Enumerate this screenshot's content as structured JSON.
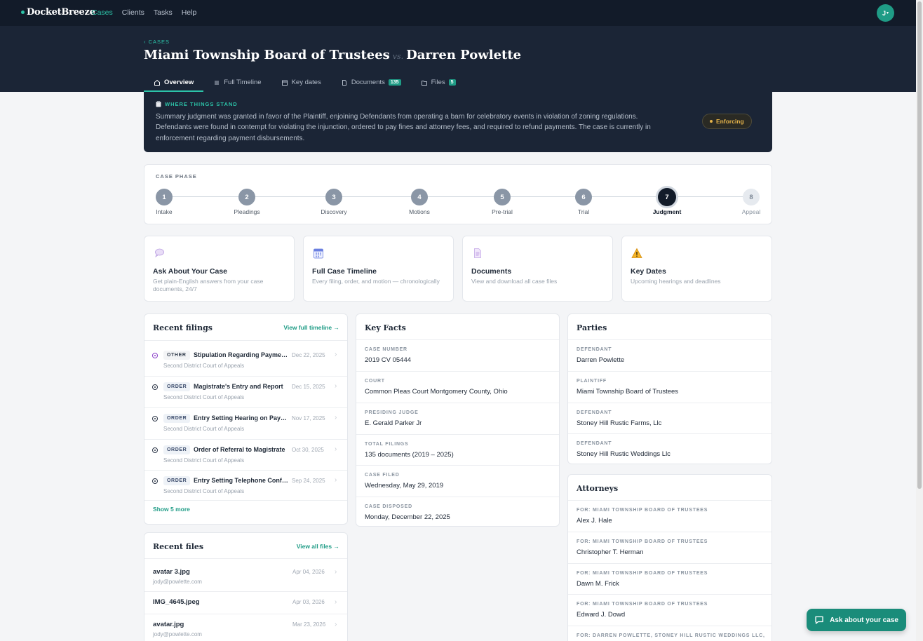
{
  "app": {
    "name": "DocketBreeze"
  },
  "nav": {
    "items": [
      "Cases",
      "Clients",
      "Tasks",
      "Help"
    ],
    "active": "Cases"
  },
  "user": {
    "initial": "J",
    "caret": "▾"
  },
  "breadcrumb": {
    "label": "‹ CASES"
  },
  "case": {
    "plaintiff": "Miami Township Board of Trustees",
    "vs": "vs.",
    "defendant": "Darren Powlette"
  },
  "tabs": [
    {
      "label": "Overview",
      "icon": "home-icon"
    },
    {
      "label": "Full Timeline",
      "icon": "list-icon"
    },
    {
      "label": "Key dates",
      "icon": "calendar-icon"
    },
    {
      "label": "Documents",
      "icon": "document-icon",
      "badge": "135"
    },
    {
      "label": "Files",
      "icon": "folder-icon",
      "badge": "5"
    }
  ],
  "where": {
    "label": "WHERE THINGS STAND",
    "text": "Summary judgment was granted in favor of the Plaintiff, enjoining Defendants from operating a barn for celebratory events in violation of zoning regulations. Defendants were found in contempt for violating the injunction, ordered to pay fines and attorney fees, and required to refund payments. The case is currently in enforcement regarding payment disbursements.",
    "status": "Enforcing"
  },
  "phase": {
    "label": "CASE PHASE",
    "current": 7,
    "steps": [
      {
        "num": "1",
        "label": "Intake"
      },
      {
        "num": "2",
        "label": "Pleadings"
      },
      {
        "num": "3",
        "label": "Discovery"
      },
      {
        "num": "4",
        "label": "Motions"
      },
      {
        "num": "5",
        "label": "Pre-trial"
      },
      {
        "num": "6",
        "label": "Trial"
      },
      {
        "num": "7",
        "label": "Judgment"
      },
      {
        "num": "8",
        "label": "Appeal"
      }
    ]
  },
  "quick": [
    {
      "title": "Ask About Your Case",
      "desc": "Get plain-English answers from your case documents, 24/7",
      "icon": "speech-bubble-icon"
    },
    {
      "title": "Full Case Timeline",
      "desc": "Every filing, order, and motion — chronologically",
      "icon": "calendar-icon"
    },
    {
      "title": "Documents",
      "desc": "View and download all case files",
      "icon": "document-icon"
    },
    {
      "title": "Key Dates",
      "desc": "Upcoming hearings and deadlines",
      "icon": "warning-icon"
    }
  ],
  "filings": {
    "title": "Recent filings",
    "link": "View full timeline →",
    "items": [
      {
        "type": "OTHER",
        "name": "Stipulation Regarding Payment Disbursement",
        "date": "Dec 22, 2025",
        "court": "Second District Court of Appeals"
      },
      {
        "type": "ORDER",
        "name": "Magistrate's Entry and Report",
        "date": "Dec 15, 2025",
        "court": "Second District Court of Appeals"
      },
      {
        "type": "ORDER",
        "name": "Entry Setting Hearing on Payment",
        "date": "Nov 17, 2025",
        "court": "Second District Court of Appeals"
      },
      {
        "type": "ORDER",
        "name": "Order of Referral to Magistrate",
        "date": "Oct 30, 2025",
        "court": "Second District Court of Appeals"
      },
      {
        "type": "ORDER",
        "name": "Entry Setting Telephone Conference",
        "date": "Sep 24, 2025",
        "court": "Second District Court of Appeals"
      }
    ],
    "more": "Show 5 more"
  },
  "files": {
    "title": "Recent files",
    "link": "View all files →",
    "items": [
      {
        "name": "avatar 3.jpg",
        "sub": "jody@powlette.com",
        "date": "Apr 04, 2026"
      },
      {
        "name": "IMG_4645.jpeg",
        "sub": "",
        "date": "Apr 03, 2026"
      },
      {
        "name": "avatar.jpg",
        "sub": "jody@powlette.com",
        "date": "Mar 23, 2026"
      }
    ]
  },
  "facts": {
    "title": "Key Facts",
    "items": [
      {
        "k": "CASE NUMBER",
        "v": "2019 CV 05444"
      },
      {
        "k": "COURT",
        "v": "Common Pleas Court Montgomery County, Ohio"
      },
      {
        "k": "PRESIDING JUDGE",
        "v": "E. Gerald Parker Jr"
      },
      {
        "k": "TOTAL FILINGS",
        "v": "135 documents (2019 – 2025)"
      },
      {
        "k": "CASE FILED",
        "v": "Wednesday, May 29, 2019"
      },
      {
        "k": "CASE DISPOSED",
        "v": "Monday, December 22, 2025"
      }
    ]
  },
  "parties": {
    "title": "Parties",
    "items": [
      {
        "k": "DEFENDANT",
        "v": "Darren Powlette"
      },
      {
        "k": "PLAINTIFF",
        "v": "Miami Township Board of Trustees"
      },
      {
        "k": "DEFENDANT",
        "v": "Stoney Hill Rustic Farms, Llc"
      },
      {
        "k": "DEFENDANT",
        "v": "Stoney Hill Rustic Weddings Llc"
      }
    ]
  },
  "attorneys": {
    "title": "Attorneys",
    "items": [
      {
        "k": "FOR: MIAMI TOWNSHIP BOARD OF TRUSTEES",
        "v": "Alex J. Hale"
      },
      {
        "k": "FOR: MIAMI TOWNSHIP BOARD OF TRUSTEES",
        "v": "Christopher T. Herman"
      },
      {
        "k": "FOR: MIAMI TOWNSHIP BOARD OF TRUSTEES",
        "v": "Dawn M. Frick"
      },
      {
        "k": "FOR: MIAMI TOWNSHIP BOARD OF TRUSTEES",
        "v": "Edward J. Dowd"
      },
      {
        "k": "FOR: DARREN POWLETTE, STONEY HILL RUSTIC WEDDINGS LLC,",
        "v": ""
      }
    ]
  },
  "fab": {
    "label": "Ask about your case",
    "icon": "chat-icon"
  },
  "colors": {
    "accent": "#2cc3a8",
    "dark": "#121b29",
    "status": "#e6b44a"
  }
}
